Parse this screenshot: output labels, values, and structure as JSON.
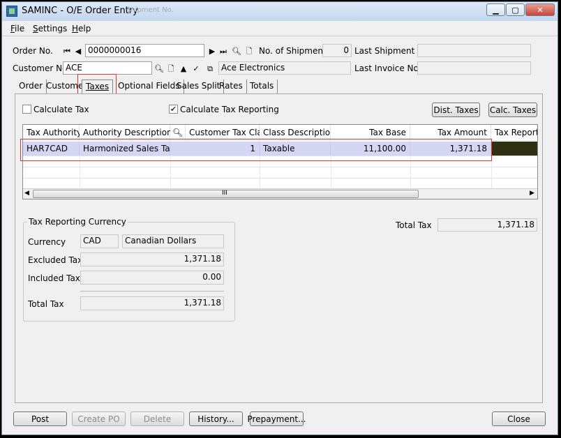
{
  "window": {
    "title": "SAMINC - O/E Order Entry",
    "ghost_text": "Shipment No."
  },
  "menu": [
    {
      "label": "File",
      "ul": "F",
      "rest": "ile"
    },
    {
      "label": "Settings",
      "ul": "S",
      "rest": "ettings"
    },
    {
      "label": "Help",
      "ul": "H",
      "rest": "elp"
    }
  ],
  "header": {
    "order_no_label": "Order No.",
    "order_no": "0000000016",
    "num_shipments_label": "No. of Shipments",
    "num_shipments": "0",
    "last_shipment_label": "Last Shipment No.",
    "last_shipment": "",
    "customer_no_label": "Customer No.",
    "customer_no": "ACE",
    "customer_name": "Ace Electronics",
    "last_invoice_label": "Last Invoice No.",
    "last_invoice": ""
  },
  "tabs": [
    "Order",
    "Customer",
    "Taxes",
    "Optional Fields",
    "Sales Split",
    "Rates",
    "Totals"
  ],
  "taxes": {
    "calc_tax_label": "Calculate Tax",
    "calc_tax_checked": false,
    "calc_tax_reporting_label": "Calculate Tax Reporting",
    "calc_tax_reporting_checked": true,
    "dist_taxes_btn": "Dist. Taxes",
    "calc_taxes_btn": "Calc. Taxes",
    "grid": {
      "columns": [
        "Tax Authority",
        "Authority Description",
        "Customer Tax Class",
        "Class Description",
        "Tax Base",
        "Tax Amount",
        "Tax Reporting"
      ],
      "rows": [
        {
          "authority": "HAR7CAD",
          "description": "Harmonized Sales Tax ...",
          "tax_class": "1",
          "class_description": "Taxable",
          "tax_base": "11,100.00",
          "tax_amount": "1,371.18",
          "tax_reporting": ""
        }
      ],
      "scroll_grip": "III"
    },
    "total_tax_label": "Total Tax",
    "total_tax": "1,371.18",
    "reporting": {
      "group_title": "Tax Reporting Currency",
      "currency_label": "Currency",
      "currency_code": "CAD",
      "currency_name": "Canadian Dollars",
      "excluded_label": "Excluded Tax",
      "excluded": "1,371.18",
      "included_label": "Included Tax",
      "included": "0.00",
      "total_label": "Total Tax",
      "total": "1,371.18"
    }
  },
  "footer": {
    "post": "Post",
    "create_po": "Create PO",
    "delete": "Delete",
    "history": "History...",
    "prepayment": "Prepayment...",
    "close": "Close"
  },
  "colors": {
    "accent": "#2d6bb5",
    "selection_row": "#d5d5f4",
    "highlight_box": "#d23a3a",
    "reporting_cell": "#2f2f12"
  }
}
